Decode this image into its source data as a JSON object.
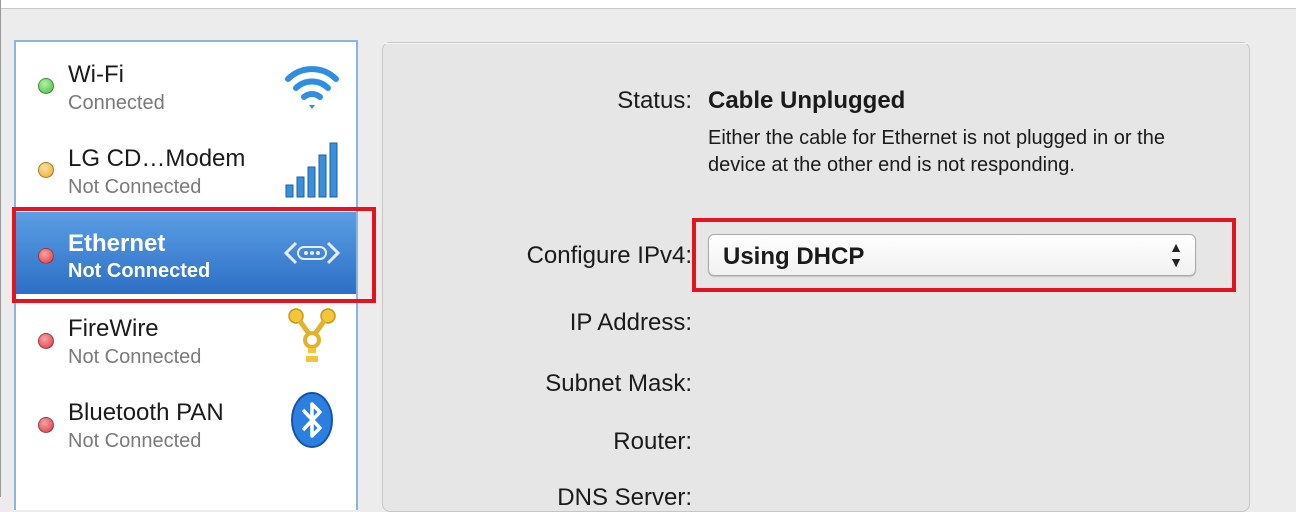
{
  "sidebar": {
    "items": [
      {
        "name": "Wi-Fi",
        "state": "Connected",
        "status_color": "#3fbf3f",
        "icon": "wifi-icon"
      },
      {
        "name": "LG CD…Modem",
        "state": "Not Connected",
        "status_color": "#f4a623",
        "icon": "signal-bars-icon"
      },
      {
        "name": "Ethernet",
        "state": "Not Connected",
        "status_color": "#d9363e",
        "icon": "ethernet-icon",
        "selected": true
      },
      {
        "name": "FireWire",
        "state": "Not Connected",
        "status_color": "#d9363e",
        "icon": "firewire-icon"
      },
      {
        "name": "Bluetooth PAN",
        "state": "Not Connected",
        "status_color": "#d9363e",
        "icon": "bluetooth-icon"
      }
    ]
  },
  "detail": {
    "status_label": "Status:",
    "status_value": "Cable Unplugged",
    "status_description": "Either the cable for Ethernet is not plugged in or the device at the other end is not responding.",
    "configure_label": "Configure IPv4:",
    "configure_value": "Using DHCP",
    "ip_label": "IP Address:",
    "subnet_label": "Subnet Mask:",
    "router_label": "Router:",
    "dns_label": "DNS Server:"
  },
  "colors": {
    "highlight": "#e3141d",
    "selection": "#3a7fd5"
  }
}
